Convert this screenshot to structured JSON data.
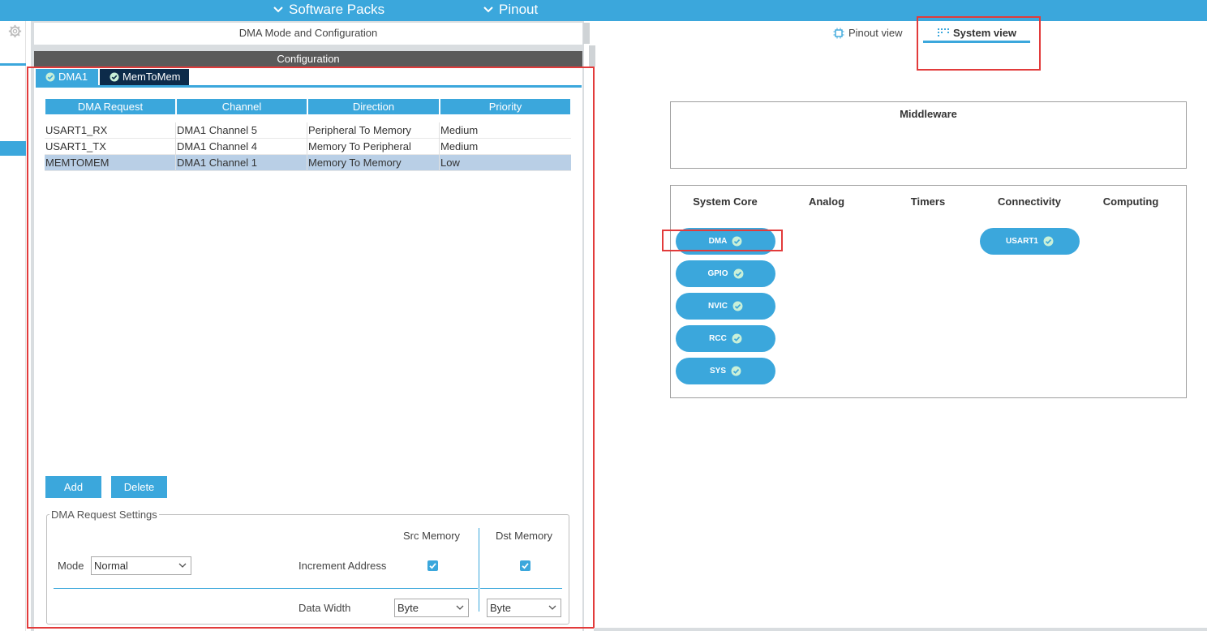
{
  "topbar": {
    "software_packs": "Software Packs",
    "pinout": "Pinout"
  },
  "left_panel": {
    "header": "DMA Mode and Configuration",
    "config_bar": "Configuration",
    "tabs": [
      {
        "label": "DMA1"
      },
      {
        "label": "MemToMem"
      }
    ],
    "table": {
      "headers": [
        "DMA Request",
        "Channel",
        "Direction",
        "Priority"
      ],
      "rows": [
        {
          "request": "USART1_RX",
          "channel": "DMA1 Channel 5",
          "direction": "Peripheral To Memory",
          "priority": "Medium"
        },
        {
          "request": "USART1_TX",
          "channel": "DMA1 Channel 4",
          "direction": "Memory To Peripheral",
          "priority": "Medium"
        },
        {
          "request": "MEMTOMEM",
          "channel": "DMA1 Channel 1",
          "direction": "Memory To Memory",
          "priority": "Low"
        }
      ]
    },
    "buttons": {
      "add": "Add",
      "delete": "Delete"
    },
    "settings": {
      "legend": "DMA Request Settings",
      "mode_label": "Mode",
      "mode_value": "Normal",
      "src_memory": "Src Memory",
      "dst_memory": "Dst Memory",
      "increment_address": "Increment Address",
      "data_width": "Data Width",
      "src_width": "Byte",
      "dst_width": "Byte",
      "src_increment_checked": true,
      "dst_increment_checked": true
    }
  },
  "right_panel": {
    "view_tabs": {
      "pinout_view": "Pinout view",
      "system_view": "System view",
      "active": "System view"
    },
    "middleware_title": "Middleware",
    "categories": [
      "System Core",
      "Analog",
      "Timers",
      "Connectivity",
      "Computing"
    ],
    "system_core_items": [
      "DMA",
      "GPIO",
      "NVIC",
      "RCC",
      "SYS"
    ],
    "connectivity_items": [
      "USART1"
    ]
  },
  "colors": {
    "accent": "#3ba7dc",
    "dark_tab": "#0d2b4a",
    "highlight": "#e23b3b",
    "selected_row": "#b9cfe6"
  }
}
